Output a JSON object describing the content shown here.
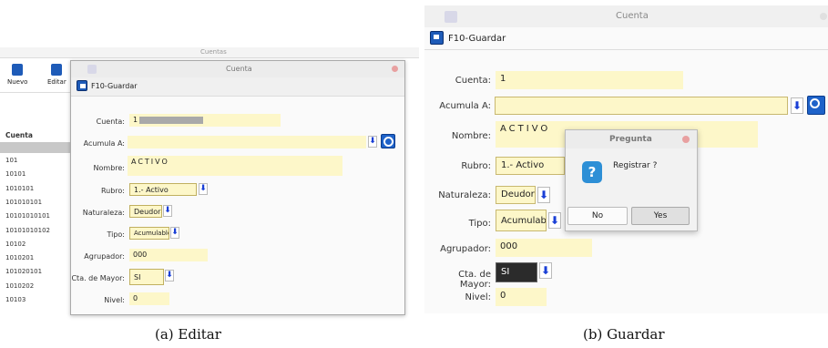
{
  "panel_a": {
    "bg_title": "Cuentas",
    "toolbar": {
      "nuevo": "Nuevo",
      "editar": "Editar"
    },
    "list_header": "Cuenta",
    "list_items": [
      "101",
      "10101",
      "1010101",
      "101010101",
      "10101010101",
      "10101010102",
      "10102",
      "1010201",
      "101020101",
      "1010202",
      "10103"
    ],
    "dialog": {
      "title": "Cuenta",
      "save": "F10-Guardar",
      "labels": {
        "cuenta": "Cuenta:",
        "acumula": "Acumula A:",
        "nombre": "Nombre:",
        "rubro": "Rubro:",
        "naturaleza": "Naturaleza:",
        "tipo": "Tipo:",
        "agrupador": "Agrupador:",
        "mayor": "Cta. de Mayor:",
        "nivel": "Nivel:"
      },
      "values": {
        "cuenta": "1",
        "acumula": "",
        "nombre": "ACTIVO",
        "rubro": "1.- Activo",
        "naturaleza": "Deudora",
        "tipo": "Acumulable",
        "agrupador": "000",
        "mayor": "SI",
        "nivel": "0"
      }
    }
  },
  "panel_b": {
    "title": "Cuenta",
    "save": "F10-Guardar",
    "labels": {
      "cuenta": "Cuenta:",
      "acumula": "Acumula A:",
      "nombre": "Nombre:",
      "rubro": "Rubro:",
      "naturaleza": "Naturaleza:",
      "tipo": "Tipo:",
      "agrupador": "Agrupador:",
      "mayor": "Cta. de Mayor:",
      "nivel": "Nivel:"
    },
    "values": {
      "cuenta": "1",
      "acumula": "",
      "nombre": "ACTIVO",
      "rubro": "1.- Activo",
      "naturaleza": "Deudora",
      "tipo": "Acumulable",
      "agrupador": "000",
      "mayor": "SI",
      "nivel": "0"
    },
    "prompt": {
      "title": "Pregunta",
      "message": "Registrar ?",
      "no": "No",
      "yes": "Yes"
    }
  },
  "captions": {
    "a": "(a)  Editar",
    "b": "(b)  Guardar"
  },
  "colors": {
    "field_bg": "#fdf7c9",
    "arrow": "#1a3fd6",
    "icon_blue": "#1e5bb8",
    "question": "#2d8fd6"
  },
  "icons": [
    "close-icon",
    "save-icon",
    "new-icon",
    "edit-icon",
    "down-arrow-icon",
    "search-icon",
    "question-icon"
  ]
}
